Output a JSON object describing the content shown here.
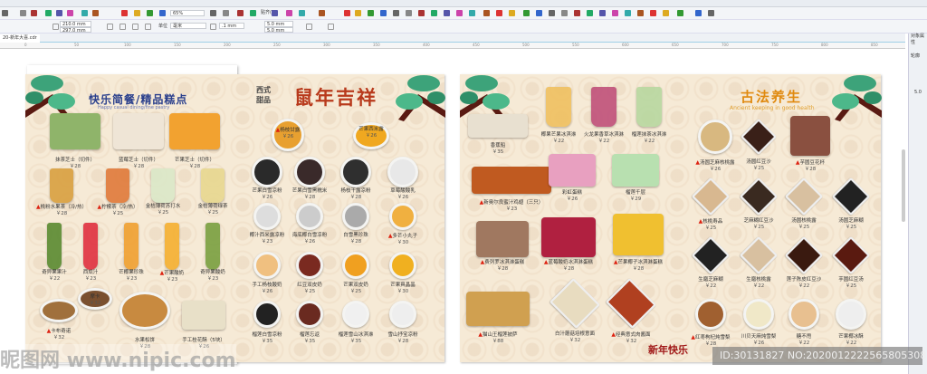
{
  "app": {
    "zoom": "65%",
    "snap_label": "贴齐(T)",
    "page_width": "210.0 mm",
    "page_height": "297.0 mm",
    "units_label": "单位",
    "units_value": "毫米",
    "nudge": ".1 mm",
    "dup_x": "5.0 mm",
    "dup_y": "5.0 mm",
    "tab": "20-新年大喜.cdr",
    "docker_title": "对象属性",
    "docker_outline": "轮廓",
    "docker_width": "5.0",
    "ruler_unit": "毫米",
    "ruler_ticks": [
      "0",
      "50",
      "100",
      "150",
      "200",
      "250",
      "300",
      "350",
      "400",
      "450",
      "500",
      "550",
      "600",
      "650",
      "700",
      "750",
      "800",
      "850"
    ]
  },
  "left_page": {
    "title": "快乐简餐/精品糕点",
    "subtitle": "Happy casual dining/fine pastry",
    "side_title": [
      "西式",
      "甜品"
    ],
    "banner": "鼠年吉祥",
    "items_a": [
      {
        "name": "抹茶芝士（切件）",
        "price": "￥28",
        "thumb": false
      },
      {
        "name": "蓝莓芝士（切件）",
        "price": "￥28",
        "thumb": false
      },
      {
        "name": "芒果芝士（切件）",
        "price": "￥28",
        "thumb": false
      },
      {
        "name": "桃粉水果茶（冷/热）",
        "price": "￥28",
        "thumb": true
      },
      {
        "name": "柠檬茶（冷/热）",
        "price": "￥25",
        "thumb": true
      },
      {
        "name": "金桔薄荷苏打水",
        "price": "￥25",
        "thumb": false
      },
      {
        "name": "金桔薄荷绿茶",
        "price": "￥25",
        "thumb": false
      },
      {
        "name": "奇异果果汁",
        "price": "￥22",
        "thumb": false
      },
      {
        "name": "西瓜汁",
        "price": "￥23",
        "thumb": false
      },
      {
        "name": "芒椰果珍珠",
        "price": "￥23",
        "thumb": false
      },
      {
        "name": "芒果酸奶",
        "price": "￥23",
        "thumb": true
      },
      {
        "name": "奇异果酸奶",
        "price": "￥23",
        "thumb": false
      },
      {
        "name": "卡布奇诺",
        "price": "￥32",
        "thumb": true
      },
      {
        "name": "摩卡",
        "price": "￥32",
        "thumb": false
      },
      {
        "name": "水果松饼",
        "price": "￥28",
        "thumb": false
      },
      {
        "name": "手工桂花酥（5块）",
        "price": "￥26",
        "thumb": false
      }
    ],
    "items_b": [
      {
        "name": "杨枝甘露",
        "price": "￥26",
        "thumb": true
      },
      {
        "name": "芒果西米露",
        "price": "￥26",
        "thumb": false
      },
      {
        "name": "芒果白雪凉粉",
        "price": "￥26",
        "thumb": false
      },
      {
        "name": "芒果白雪黑糯米",
        "price": "￥28",
        "thumb": false
      },
      {
        "name": "杨枝干露凉粉",
        "price": "￥28",
        "thumb": false
      },
      {
        "name": "草莓酸酸乳",
        "price": "￥26",
        "thumb": false
      },
      {
        "name": "椰汁西米露凉粉",
        "price": "￥23",
        "thumb": false
      },
      {
        "name": "海底椰白雪凉粉",
        "price": "￥26",
        "thumb": false
      },
      {
        "name": "白雪黑珍珠",
        "price": "￥28",
        "thumb": false
      },
      {
        "name": "多芒小丸子",
        "price": "￥30",
        "thumb": true
      },
      {
        "name": "手工杨枝酸奶",
        "price": "￥26",
        "thumb": false
      },
      {
        "name": "红豆双皮奶",
        "price": "￥25",
        "thumb": false
      },
      {
        "name": "芒果双皮奶",
        "price": "￥25",
        "thumb": false
      },
      {
        "name": "芒果爽晶晶",
        "price": "￥30",
        "thumb": false
      },
      {
        "name": "榴莲白雪凉粉",
        "price": "￥35",
        "thumb": false
      },
      {
        "name": "榴莲忘返",
        "price": "￥35",
        "thumb": false
      },
      {
        "name": "榴莲雪山冰淇淋",
        "price": "￥35",
        "thumb": false
      },
      {
        "name": "雪山抒宝凉粉",
        "price": "￥28",
        "thumb": false
      }
    ]
  },
  "right_page": {
    "title": "古法养生",
    "subtitle": "Ancient keeping in good health",
    "footer": "新年快乐",
    "items_c": [
      {
        "name": "香蕉船",
        "price": "￥35",
        "thumb": false
      },
      {
        "name": "椰果芒果冰淇淋",
        "price": "￥22",
        "thumb": false
      },
      {
        "name": "火龙果香草冰淇淋",
        "price": "￥22",
        "thumb": false
      },
      {
        "name": "榴莲抹茶冰淇淋",
        "price": "￥22",
        "thumb": false
      },
      {
        "name": "新奥尔良蜜汁鸡翅（三只）",
        "price": "￥23",
        "thumb": true
      },
      {
        "name": "彩虹蛋糕",
        "price": "￥26",
        "thumb": false
      },
      {
        "name": "榴莲千层",
        "price": "￥29",
        "thumb": false
      },
      {
        "name": "费列罗冰淇淋蛋糕",
        "price": "￥28",
        "thumb": true
      },
      {
        "name": "蓝莓酸奶冰淇淋蛋糕",
        "price": "￥28",
        "thumb": true
      },
      {
        "name": "芒果椰子冰淇淋蛋糕",
        "price": "￥28",
        "thumb": true
      },
      {
        "name": "猫山王榴莲披萨",
        "price": "￥88",
        "thumb": true
      },
      {
        "name": "白汁蘑菇培根意面",
        "price": "￥32",
        "thumb": false
      },
      {
        "name": "经典意式肉酱面",
        "price": "￥32",
        "thumb": true
      }
    ],
    "items_d": [
      {
        "name": "汤圆芝麻核桃露",
        "price": "￥26",
        "thumb": true
      },
      {
        "name": "汤圆红豆沙",
        "price": "￥25",
        "thumb": false
      },
      {
        "name": "芋圆豆花杯",
        "price": "￥28",
        "thumb": true
      },
      {
        "name": "核桃寿品",
        "price": "￥25",
        "thumb": true
      },
      {
        "name": "芝麻糊红豆沙",
        "price": "￥25",
        "thumb": false
      },
      {
        "name": "汤圆核桃露",
        "price": "￥25",
        "thumb": false
      },
      {
        "name": "汤圆芝麻糊",
        "price": "￥25",
        "thumb": false
      },
      {
        "name": "生磨芝麻糊",
        "price": "￥22",
        "thumb": false
      },
      {
        "name": "生磨核桃露",
        "price": "￥22",
        "thumb": false
      },
      {
        "name": "莲子陈皮红豆沙",
        "price": "￥22",
        "thumb": false
      },
      {
        "name": "芋圆红豆汤",
        "price": "￥25",
        "thumb": false
      },
      {
        "name": "红枣枸杞炖雪梨",
        "price": "￥28",
        "thumb": true
      },
      {
        "name": "川贝天麻炖雪梨",
        "price": "￥26",
        "thumb": false
      },
      {
        "name": "糖不甩",
        "price": "￥22",
        "thumb": false
      },
      {
        "name": "芒果椰冰酥",
        "price": "￥22",
        "thumb": false
      }
    ]
  },
  "watermark": {
    "site": "昵图网 www.nipic.com",
    "id": "ID:30131827 NO:20200122225658053082"
  },
  "thumb_icon": "thumbs-up-icon"
}
